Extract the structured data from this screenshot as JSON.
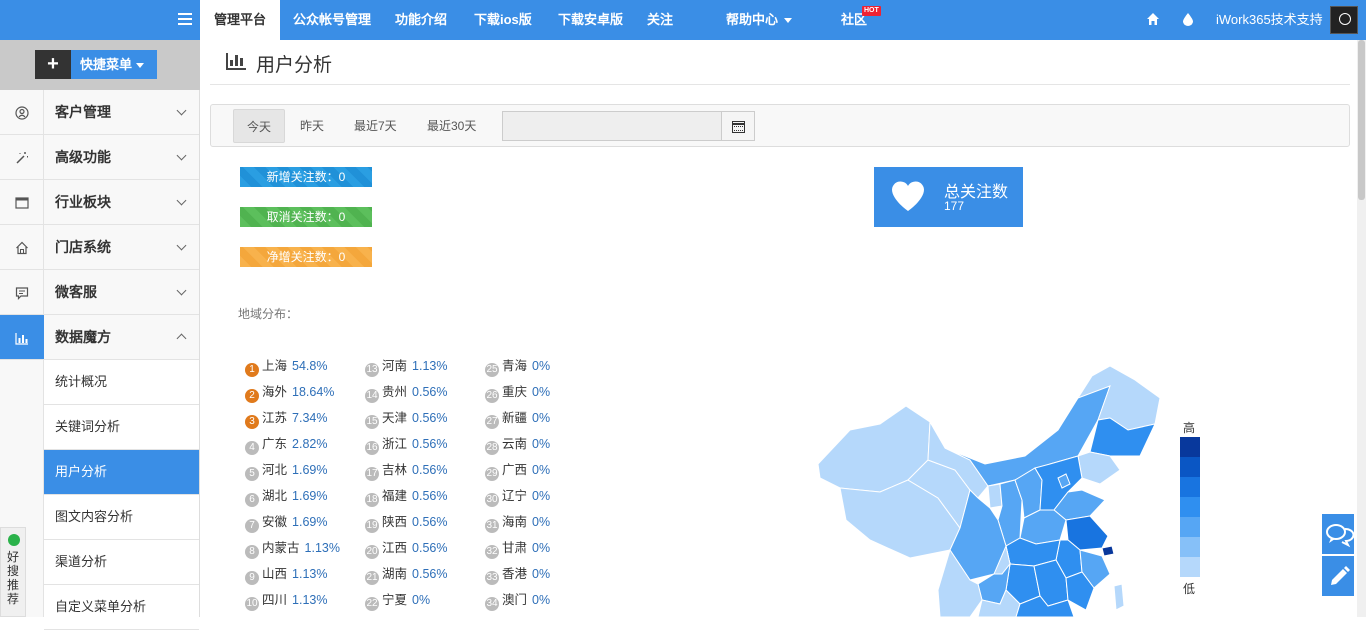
{
  "nav": {
    "items": [
      {
        "label": "管理平台",
        "active": true
      },
      {
        "label": "公众帐号管理"
      },
      {
        "label": "功能介绍"
      },
      {
        "label": "下载ios版"
      },
      {
        "label": "下载安卓版"
      },
      {
        "label": "关注"
      },
      {
        "label": "帮助中心"
      },
      {
        "label": "社区"
      }
    ],
    "hot_badge": "HOT",
    "user": "iWork365技术支持"
  },
  "sidebar": {
    "quick_menu": "快捷菜单",
    "quick_plus": "+",
    "menus": [
      {
        "label": "客户管理",
        "icon": "user-circle-icon"
      },
      {
        "label": "高级功能",
        "icon": "magic-wand-icon"
      },
      {
        "label": "行业板块",
        "icon": "window-icon"
      },
      {
        "label": "门店系统",
        "icon": "home-icon"
      },
      {
        "label": "微客服",
        "icon": "chat-icon"
      },
      {
        "label": "数据魔方",
        "icon": "bar-chart-icon",
        "open": true
      }
    ],
    "submenu": [
      "统计概况",
      "关键词分析",
      "用户分析",
      "图文内容分析",
      "渠道分析",
      "自定义菜单分析"
    ],
    "active_sub": "用户分析",
    "recommend": "好搜推荐"
  },
  "main": {
    "title": "用户分析",
    "tabs": [
      "今天",
      "昨天",
      "最近7天",
      "最近30天"
    ],
    "active_tab": "今天",
    "date_value": "",
    "badges": {
      "new_follow": "新增关注数：0",
      "unfollow": "取消关注数：0",
      "net_follow": "净增关注数：0"
    },
    "total": {
      "label": "总关注数",
      "value": "177"
    },
    "region_label": "地域分布：",
    "legend": {
      "high": "高",
      "low": "低",
      "colors": [
        "#08389c",
        "#0a56c4",
        "#1874e0",
        "#2f8ff0",
        "#56a6f4",
        "#86c0f8",
        "#b5d8fb"
      ]
    },
    "regions": [
      {
        "rank": "1",
        "name": "上海",
        "pct": "54.8%"
      },
      {
        "rank": "2",
        "name": "海外",
        "pct": "18.64%"
      },
      {
        "rank": "3",
        "name": "江苏",
        "pct": "7.34%"
      },
      {
        "rank": "4",
        "name": "广东",
        "pct": "2.82%"
      },
      {
        "rank": "5",
        "name": "河北",
        "pct": "1.69%"
      },
      {
        "rank": "6",
        "name": "湖北",
        "pct": "1.69%"
      },
      {
        "rank": "7",
        "name": "安徽",
        "pct": "1.69%"
      },
      {
        "rank": "8",
        "name": "内蒙古",
        "pct": "1.13%"
      },
      {
        "rank": "9",
        "name": "山西",
        "pct": "1.13%"
      },
      {
        "rank": "10",
        "name": "四川",
        "pct": "1.13%"
      },
      {
        "rank": "13",
        "name": "河南",
        "pct": "1.13%"
      },
      {
        "rank": "14",
        "name": "贵州",
        "pct": "0.56%"
      },
      {
        "rank": "15",
        "name": "天津",
        "pct": "0.56%"
      },
      {
        "rank": "16",
        "name": "浙江",
        "pct": "0.56%"
      },
      {
        "rank": "17",
        "name": "吉林",
        "pct": "0.56%"
      },
      {
        "rank": "18",
        "name": "福建",
        "pct": "0.56%"
      },
      {
        "rank": "19",
        "name": "陕西",
        "pct": "0.56%"
      },
      {
        "rank": "20",
        "name": "江西",
        "pct": "0.56%"
      },
      {
        "rank": "21",
        "name": "湖南",
        "pct": "0.56%"
      },
      {
        "rank": "22",
        "name": "宁夏",
        "pct": "0%"
      },
      {
        "rank": "25",
        "name": "青海",
        "pct": "0%"
      },
      {
        "rank": "26",
        "name": "重庆",
        "pct": "0%"
      },
      {
        "rank": "27",
        "name": "新疆",
        "pct": "0%"
      },
      {
        "rank": "28",
        "name": "云南",
        "pct": "0%"
      },
      {
        "rank": "29",
        "name": "广西",
        "pct": "0%"
      },
      {
        "rank": "30",
        "name": "辽宁",
        "pct": "0%"
      },
      {
        "rank": "31",
        "name": "海南",
        "pct": "0%"
      },
      {
        "rank": "32",
        "name": "甘肃",
        "pct": "0%"
      },
      {
        "rank": "33",
        "name": "香港",
        "pct": "0%"
      },
      {
        "rank": "34",
        "name": "澳门",
        "pct": "0%"
      }
    ]
  }
}
